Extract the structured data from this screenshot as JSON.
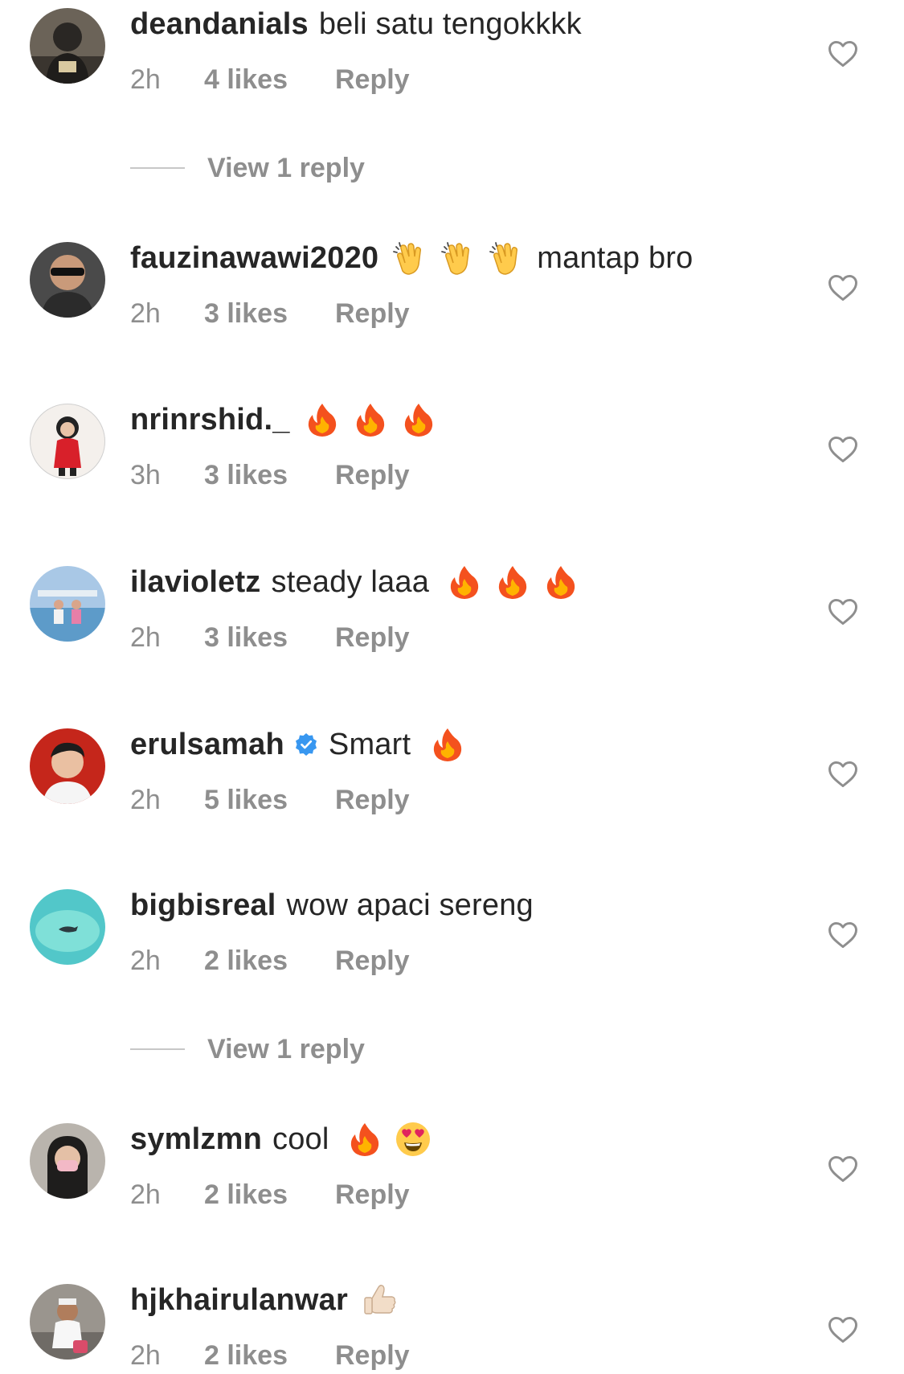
{
  "comments": [
    {
      "username": "deandanials",
      "text": "beli satu tengokkkk",
      "emojis": [],
      "time": "2h",
      "likes": "4 likes",
      "reply": "Reply",
      "verified": false
    },
    {
      "username": "fauzinawawi2020",
      "text": "",
      "emojis": [
        "clap",
        "clap",
        "clap"
      ],
      "trailing_text": "mantap bro",
      "time": "2h",
      "likes": "3 likes",
      "reply": "Reply",
      "verified": false
    },
    {
      "username": "nrinrshid._",
      "text": "",
      "emojis": [
        "fire",
        "fire",
        "fire"
      ],
      "time": "3h",
      "likes": "3 likes",
      "reply": "Reply",
      "verified": false
    },
    {
      "username": "ilavioletz",
      "text": "steady laaa",
      "emojis": [
        "fire",
        "fire",
        "fire"
      ],
      "time": "2h",
      "likes": "3 likes",
      "reply": "Reply",
      "verified": false
    },
    {
      "username": "erulsamah",
      "text": "Smart",
      "emojis": [
        "fire"
      ],
      "time": "2h",
      "likes": "5 likes",
      "reply": "Reply",
      "verified": true
    },
    {
      "username": "bigbisreal",
      "text": "wow apaci sereng",
      "emojis": [],
      "time": "2h",
      "likes": "2 likes",
      "reply": "Reply",
      "verified": false
    },
    {
      "username": "symlzmn",
      "text": "cool",
      "emojis": [
        "fire",
        "heart-eyes"
      ],
      "time": "2h",
      "likes": "2 likes",
      "reply": "Reply",
      "verified": false
    },
    {
      "username": "hjkhairulanwar",
      "text": "",
      "emojis": [
        "thumbs-up"
      ],
      "time": "2h",
      "likes": "2 likes",
      "reply": "Reply",
      "verified": false
    }
  ],
  "view_replies": [
    {
      "label": "View 1 reply"
    },
    {
      "label": "View 1 reply"
    }
  ],
  "colors": {
    "primary_text": "#262626",
    "secondary_text": "#8e8e8e",
    "verified_blue": "#3897f0",
    "divider": "#c7c7c7"
  },
  "icons": {
    "like": "heart-outline-icon",
    "verified": "verified-badge-icon"
  }
}
